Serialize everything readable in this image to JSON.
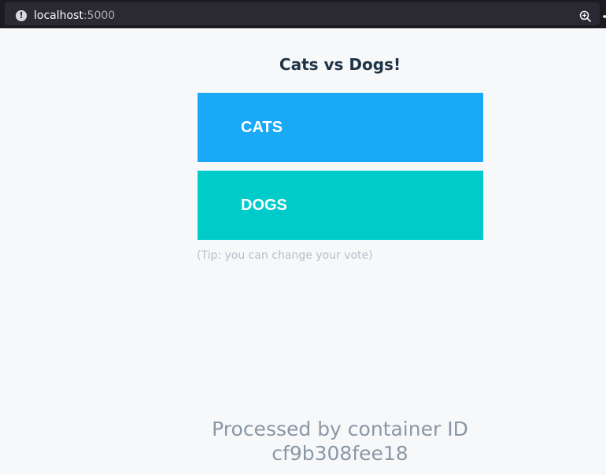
{
  "browser": {
    "url_host": "localhost",
    "url_port": ":5000",
    "icons": [
      "info-icon",
      "zoom-icon",
      "share-icon"
    ]
  },
  "page": {
    "title": "Cats vs Dogs!",
    "options": [
      {
        "label": "CATS",
        "color": "#1aa9f7"
      },
      {
        "label": "DOGS",
        "color": "#00cbcb"
      }
    ],
    "tip": "(Tip: you can change your vote)",
    "footer_line1": "Processed by container ID",
    "footer_line2": "cf9b308fee18"
  },
  "colors": {
    "background": "#f7f8fa",
    "title": "#1f3346",
    "tip": "#b5bfc8",
    "footer": "#8a98a6"
  }
}
